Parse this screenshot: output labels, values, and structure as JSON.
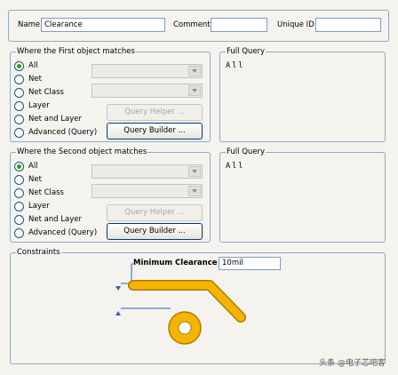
{
  "header": {
    "name_label": "Name",
    "name_value": "Clearance",
    "comment_label": "Comment",
    "comment_value": "",
    "unique_id_label": "Unique ID",
    "unique_id_value": ""
  },
  "first": {
    "legend": "Where the First object matches",
    "options": [
      "All",
      "Net",
      "Net Class",
      "Layer",
      "Net and Layer",
      "Advanced (Query)"
    ],
    "selected": "All",
    "query_helper_label": "Query Helper ...",
    "query_builder_label": "Query Builder ...",
    "full_query_legend": "Full Query",
    "full_query_text": "All"
  },
  "second": {
    "legend": "Where the Second object matches",
    "options": [
      "All",
      "Net",
      "Net Class",
      "Layer",
      "Net and Layer",
      "Advanced (Query)"
    ],
    "selected": "All",
    "query_helper_label": "Query Helper ...",
    "query_builder_label": "Query Builder ...",
    "full_query_legend": "Full Query",
    "full_query_text": "All"
  },
  "constraints": {
    "legend": "Constraints",
    "min_clearance_label": "Minimum Clearance",
    "min_clearance_value": "10mil"
  },
  "colors": {
    "copper": "#f4b400",
    "dimension": "#2b63c8"
  },
  "watermark": "头条 @电子芯吧客"
}
